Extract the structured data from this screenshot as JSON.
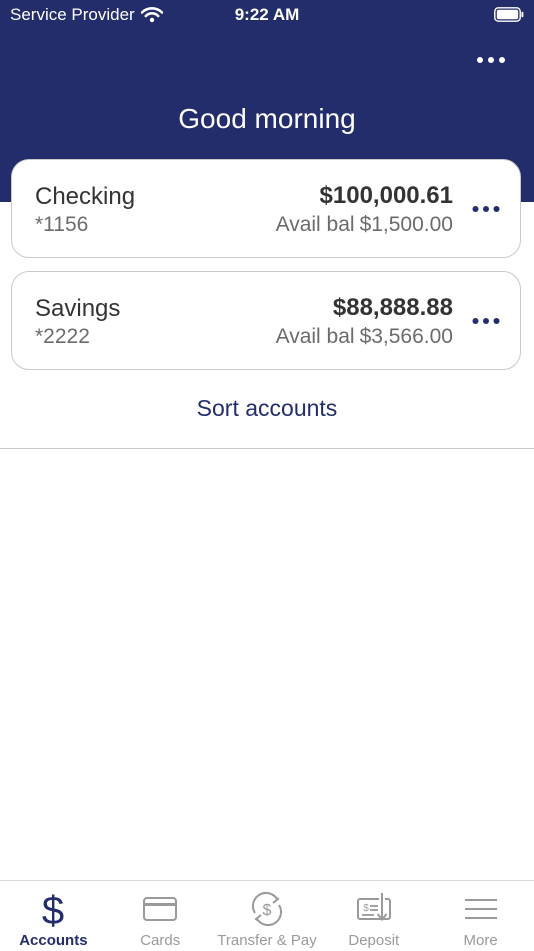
{
  "status_bar": {
    "carrier": "Service Provider",
    "time": "9:22 AM"
  },
  "header": {
    "greeting": "Good morning"
  },
  "accounts": [
    {
      "name": "Checking",
      "number": "*1156",
      "balance": "$100,000.61",
      "avail_label": "Avail bal",
      "avail_value": "$1,500.00"
    },
    {
      "name": "Savings",
      "number": "*2222",
      "balance": "$88,888.88",
      "avail_label": "Avail bal",
      "avail_value": "$3,566.00"
    }
  ],
  "sort_label": "Sort accounts",
  "tabs": [
    {
      "label": "Accounts",
      "icon": "dollar-icon",
      "active": true
    },
    {
      "label": "Cards",
      "icon": "card-icon",
      "active": false
    },
    {
      "label": "Transfer & Pay",
      "icon": "transfer-icon",
      "active": false
    },
    {
      "label": "Deposit",
      "icon": "check-deposit-icon",
      "active": false
    },
    {
      "label": "More",
      "icon": "hamburger-icon",
      "active": false
    }
  ],
  "colors": {
    "brand": "#232d6b",
    "inactive": "#9a9a9a",
    "border": "#c9c9c9"
  }
}
